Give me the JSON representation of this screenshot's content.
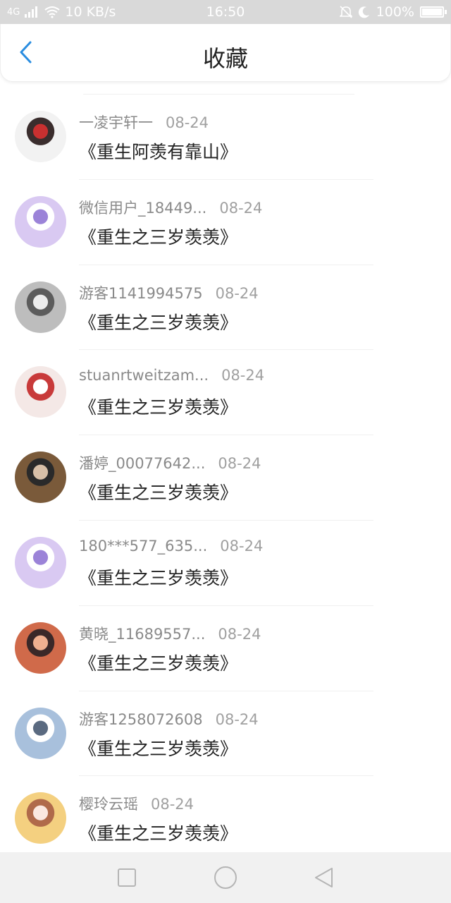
{
  "status_bar": {
    "signal": "4G",
    "speed": "10 KB/s",
    "time": "16:50",
    "battery": "100%",
    "battery_level": 1.0,
    "icons": [
      "signal-icon",
      "wifi-icon",
      "mute-bell-icon",
      "moon-icon",
      "battery-icon"
    ]
  },
  "header": {
    "title": "收藏",
    "back_icon": "chevron-left-icon",
    "accent": "#2a8de0"
  },
  "items": [
    {
      "username": "一凌宇轩一",
      "date": "08-24",
      "book": "《重生阿羡有靠山》",
      "avatar_colors": [
        "#f2f2f2",
        "#3a2d2d",
        "#c83030"
      ]
    },
    {
      "username": "微信用户_18449...",
      "date": "08-24",
      "book": "《重生之三岁羡羡》",
      "avatar_colors": [
        "#d9c9f2",
        "#ffffff",
        "#9b83d8"
      ]
    },
    {
      "username": "游客1141994575",
      "date": "08-24",
      "book": "《重生之三岁羡羡》",
      "avatar_colors": [
        "#bdbdbd",
        "#5c5c5c",
        "#ececec"
      ]
    },
    {
      "username": "stuanrtweitzam...",
      "date": "08-24",
      "book": "《重生之三岁羡羡》",
      "avatar_colors": [
        "#f4e8e6",
        "#c83a3a",
        "#ffffff"
      ]
    },
    {
      "username": "潘婷_00077642...",
      "date": "08-24",
      "book": "《重生之三岁羡羡》",
      "avatar_colors": [
        "#7a5a3a",
        "#2a2a2a",
        "#d8c0a8"
      ]
    },
    {
      "username": "180***577_635...",
      "date": "08-24",
      "book": "《重生之三岁羡羡》",
      "avatar_colors": [
        "#d9c9f2",
        "#ffffff",
        "#9b83d8"
      ]
    },
    {
      "username": "黄晓_11689557...",
      "date": "08-24",
      "book": "《重生之三岁羡羡》",
      "avatar_colors": [
        "#d06a4a",
        "#3a2828",
        "#f0b090"
      ]
    },
    {
      "username": "游客1258072608",
      "date": "08-24",
      "book": "《重生之三岁羡羡》",
      "avatar_colors": [
        "#a8c0dc",
        "#ffffff",
        "#5a6a80"
      ]
    },
    {
      "username": "樱玲云瑶",
      "date": "08-24",
      "book": "《重生之三岁羡羡》",
      "avatar_colors": [
        "#f4d080",
        "#b06a4a",
        "#fbe8e0"
      ]
    }
  ],
  "nav_bar": {
    "recent_icon": "square-icon",
    "home_icon": "circle-icon",
    "back_icon": "triangle-back-icon"
  }
}
